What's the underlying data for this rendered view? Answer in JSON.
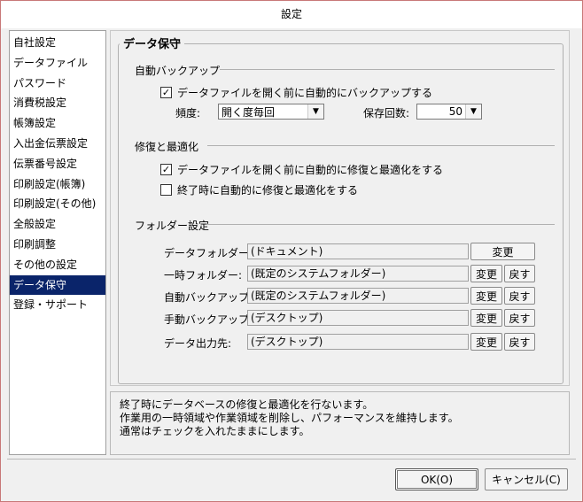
{
  "window": {
    "title": "設定"
  },
  "sidebar": {
    "items": [
      "自社設定",
      "データファイル",
      "パスワード",
      "消費税設定",
      "帳簿設定",
      "入出金伝票設定",
      "伝票番号設定",
      "印刷設定(帳簿)",
      "印刷設定(その他)",
      "全般設定",
      "印刷調整",
      "その他の設定",
      "データ保守",
      "登録・サポート"
    ],
    "selected_index": 12
  },
  "main": {
    "section_title": "データ保守",
    "backup": {
      "heading": "自動バックアップ",
      "checkbox_label": "データファイルを開く前に自動的にバックアップする",
      "checked": true,
      "frequency_label": "頻度:",
      "frequency_value": "開く度毎回",
      "count_label": "保存回数:",
      "count_value": "50"
    },
    "repair": {
      "heading": "修復と最適化",
      "check1_label": "データファイルを開く前に自動的に修復と最適化をする",
      "check1_checked": true,
      "check2_label": "終了時に自動的に修復と最適化をする",
      "check2_checked": false
    },
    "folders": {
      "heading": "フォルダー設定",
      "change_label": "変更",
      "reset_label": "戻す",
      "rows": [
        {
          "label": "データフォルダー:",
          "path": "(ドキュメント)"
        },
        {
          "label": "一時フォルダー:",
          "path": "(既定のシステムフォルダー)"
        },
        {
          "label": "自動バックアップ:",
          "path": "(既定のシステムフォルダー)"
        },
        {
          "label": "手動バックアップ:",
          "path": "(デスクトップ)"
        },
        {
          "label": "データ出力先:",
          "path": "(デスクトップ)"
        }
      ]
    }
  },
  "description": {
    "lines": [
      "終了時にデータベースの修復と最適化を行ないます。",
      "作業用の一時領域や作業領域を削除し、パフォーマンスを維持します。",
      "通常はチェックを入れたままにします。"
    ]
  },
  "footer": {
    "ok_label": "OK(O)",
    "cancel_label": "キャンセル(C)"
  }
}
